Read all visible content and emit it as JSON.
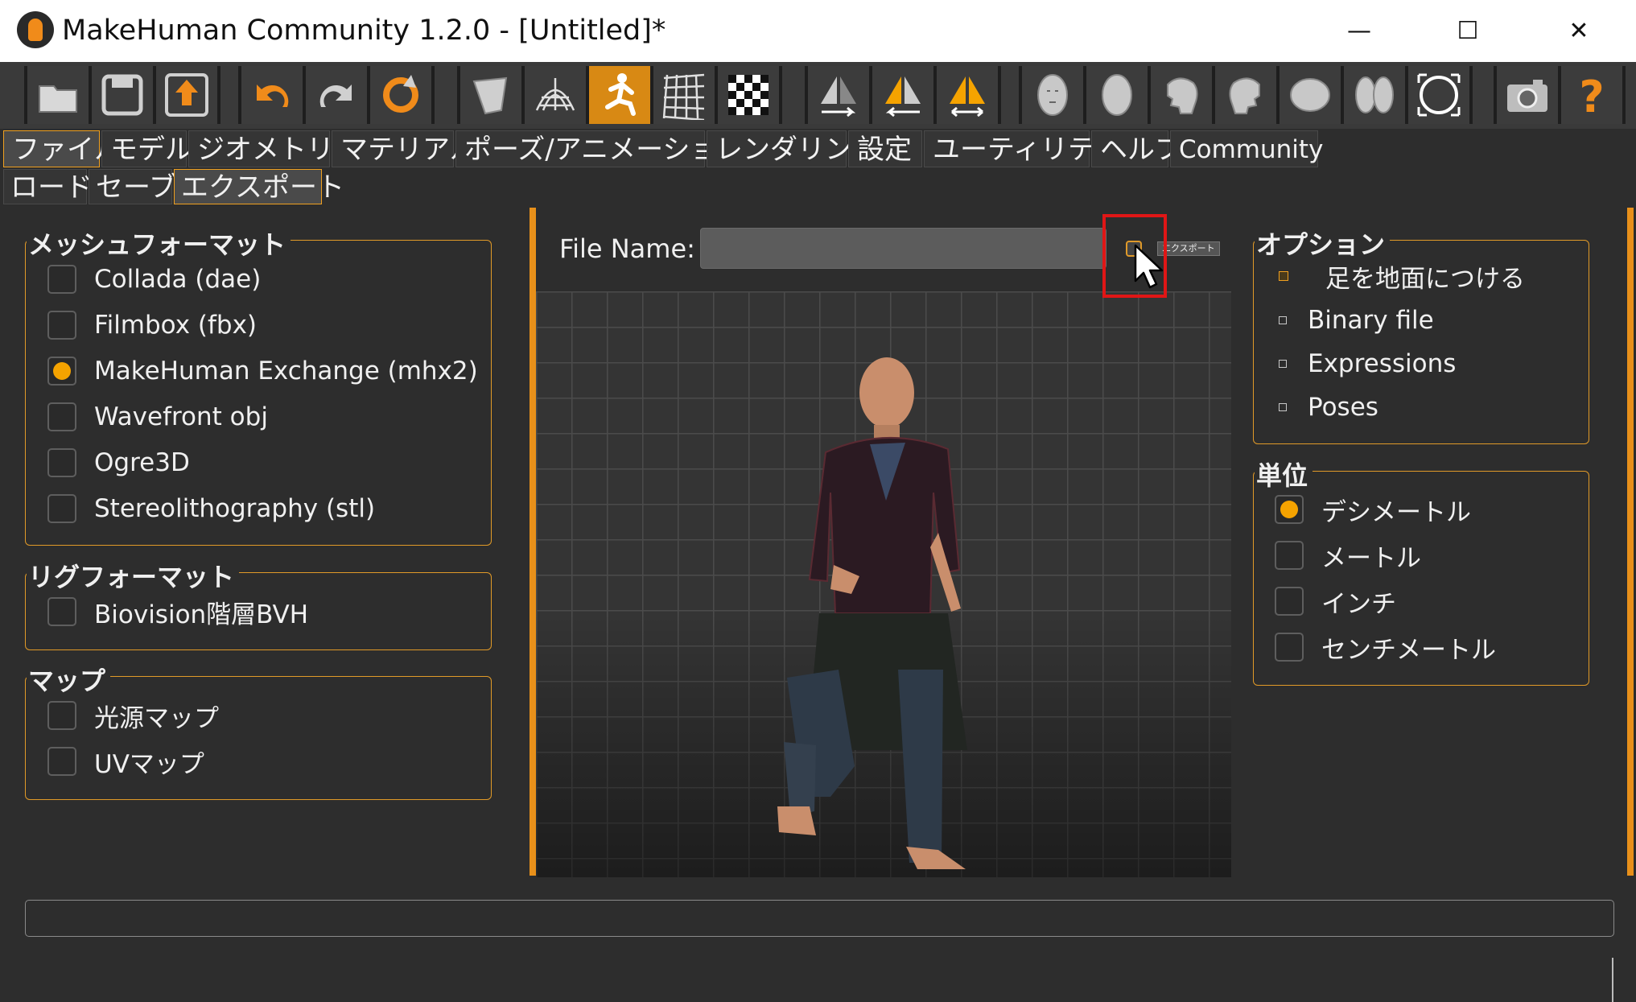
{
  "window": {
    "title": "MakeHuman Community 1.2.0 - [Untitled]*",
    "minimize": "—",
    "maximize": "☐",
    "close": "✕"
  },
  "toolbar": {
    "groups": [
      [
        "folder-open-icon",
        "save-icon",
        "export-upload-icon"
      ],
      [
        "undo-icon",
        "redo-icon",
        "reset-icon"
      ],
      [
        "smooth-icon",
        "wireframe-icon",
        "pose-icon",
        "grid-icon",
        "checker-icon"
      ],
      [
        "front-view-icon",
        "back-view-icon",
        "left-right-view-icon"
      ],
      [
        "face-icon",
        "head-side-icon",
        "head-left-icon",
        "head-right-icon",
        "head-top-icon",
        "head-bottom-icon",
        "reset-camera-icon"
      ],
      [
        "camera-icon",
        "help-icon"
      ]
    ],
    "accent": "#f08b1a"
  },
  "tabs": [
    "ファイル",
    "モデル",
    "ジオメトリー",
    "マテリアル",
    "ポーズ/アニメーション",
    "レンダリング",
    "設定",
    "ユーティリティ",
    "ヘルプ",
    "Community"
  ],
  "subtabs": [
    "ロード",
    "セーブ",
    "エクスポート"
  ],
  "left": {
    "mesh_format": {
      "title": "メッシュフォーマット",
      "items": [
        "Collada (dae)",
        "Filmbox (fbx)",
        "MakeHuman Exchange (mhx2)",
        "Wavefront obj",
        "Ogre3D",
        "Stereolithography (stl)"
      ],
      "selected": "MakeHuman Exchange (mhx2)"
    },
    "rig_format": {
      "title": "リグフォーマット",
      "items": [
        "Biovision階層BVH"
      ]
    },
    "maps": {
      "title": "マップ",
      "items": [
        "光源マップ",
        "UVマップ"
      ]
    }
  },
  "center": {
    "file_name_label": "File Name:",
    "file_name_value": "",
    "export_tooltip": "エクスポート"
  },
  "right": {
    "options": {
      "title": "オプション",
      "items": [
        "足を地面につける",
        "Binary file",
        "Expressions",
        "Poses"
      ],
      "checked": "足を地面につける"
    },
    "units": {
      "title": "単位",
      "items": [
        "デシメートル",
        "メートル",
        "インチ",
        "センチメートル"
      ],
      "selected": "デシメートル"
    }
  },
  "status": {
    "text": ""
  },
  "colors": {
    "accent": "#f0a020",
    "background": "#2d2d2d",
    "highlight": "#e01616"
  }
}
